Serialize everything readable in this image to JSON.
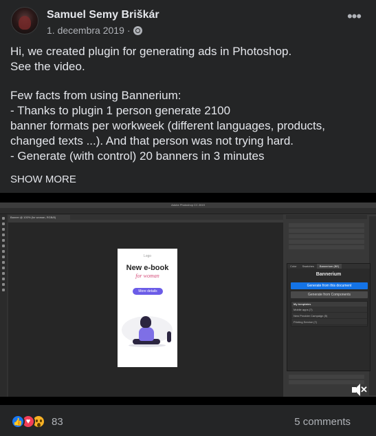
{
  "post": {
    "author": "Samuel Semy Briškár",
    "date": "1. decembra 2019",
    "separator": "·",
    "privacy_icon": "friends-icon",
    "menu_icon": "more-options-icon",
    "menu_label": "•••",
    "paragraphs": [
      "Hi, we created plugin for generating ads in Photoshop.\nSee the video.",
      "Few facts from using Bannerium:\n- Thanks to plugin 1 person generate 2100\nbanner formats per workweek (different languages, products, changed texts ...). And that person was not trying hard.\n- Generate (with control) 20 banners in 3 minutes"
    ],
    "show_more": "SHOW MORE"
  },
  "video": {
    "window_title": "Adobe Photoshop CC 2019",
    "doc_tab": "Banner @ 100% (for woman, RGB/8)",
    "ad": {
      "logo": "Logo",
      "title": "New e-book",
      "subtitle": "for woman",
      "button": "More details"
    },
    "plugin": {
      "tabs": [
        "Color",
        "Swatches",
        "Bannerium (BE)"
      ],
      "heading": "Bannerium",
      "primary_button": "Generate from this document",
      "secondary_button": "Generate from Components",
      "templates_header": "My templates",
      "templates": [
        "Mobile apps (7)",
        "New Provider Campaign (5)",
        "Printing Service (7)"
      ]
    },
    "mute_icon": "mute-speaker-icon",
    "mute_mark": "✕"
  },
  "footer": {
    "reaction_icons": [
      "like-reaction-icon",
      "love-reaction-icon",
      "wow-reaction-icon"
    ],
    "like_glyph": "👍",
    "love_glyph": "♥",
    "reaction_count": "83",
    "comments": "5 comments"
  },
  "colors": {
    "background": "#242526",
    "text": "#e4e6eb",
    "secondary_text": "#b0b3b8",
    "like": "#1877f2",
    "love": "#f33e58",
    "wow": "#f7b125",
    "plugin_primary": "#1473e6"
  }
}
